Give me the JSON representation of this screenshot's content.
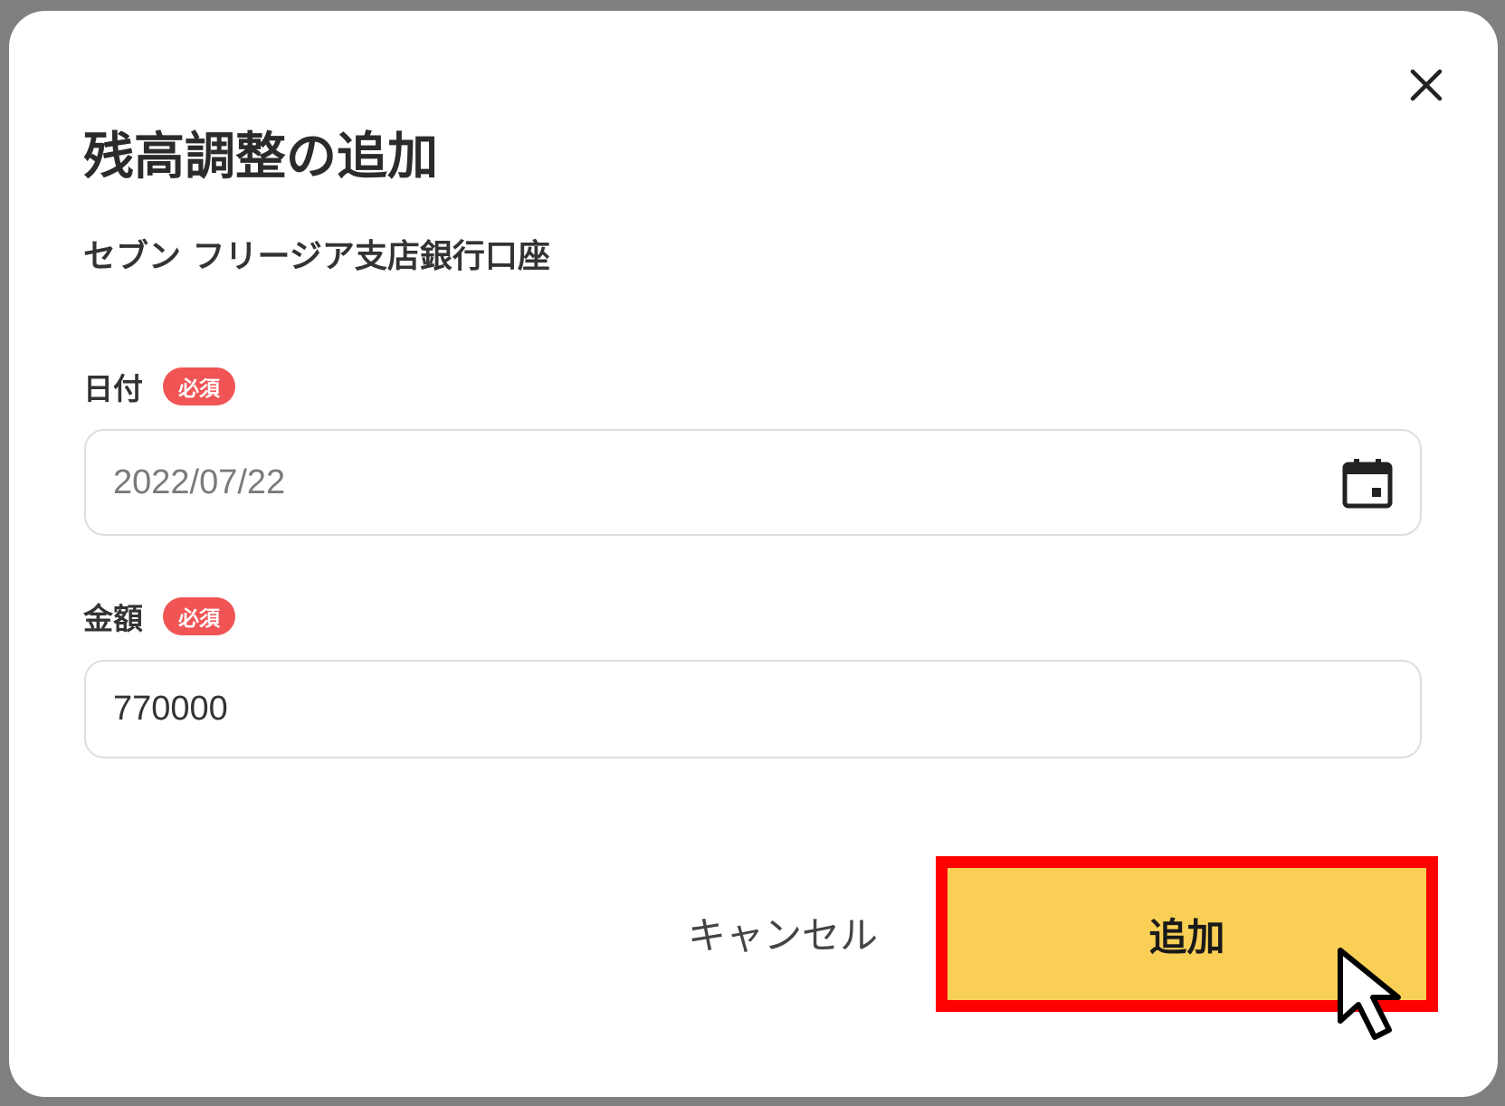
{
  "dialog": {
    "title": "残高調整の追加",
    "account_name": "セブン フリージア支店銀行口座",
    "close_icon": "close-icon"
  },
  "fields": {
    "date": {
      "label": "日付",
      "required_badge": "必須",
      "value": "2022/07/22",
      "icon": "calendar-icon"
    },
    "amount": {
      "label": "金額",
      "required_badge": "必須",
      "value": "770000"
    }
  },
  "actions": {
    "cancel_label": "キャンセル",
    "add_label": "追加"
  },
  "colors": {
    "primary_button": "#f9cf55",
    "required_badge": "#f05454",
    "highlight": "#ff0000",
    "date_text": "#7a7a7a",
    "amount_text": "#333333"
  }
}
